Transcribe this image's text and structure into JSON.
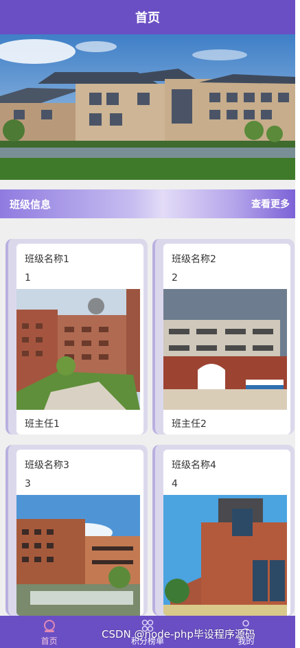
{
  "header": {
    "title": "首页"
  },
  "section": {
    "title": "班级信息",
    "more_label": "查看更多"
  },
  "cards": [
    {
      "name": "班级名称1",
      "number": "1",
      "teacher": "班主任1"
    },
    {
      "name": "班级名称2",
      "number": "2",
      "teacher": "班主任2"
    },
    {
      "name": "班级名称3",
      "number": "3",
      "teacher": ""
    },
    {
      "name": "班级名称4",
      "number": "4",
      "teacher": ""
    }
  ],
  "tabbar": {
    "items": [
      {
        "label": "首页",
        "icon": "home-icon",
        "active": true
      },
      {
        "label": "积分榜单",
        "icon": "ranking-icon",
        "active": false
      },
      {
        "label": "我的",
        "icon": "user-icon",
        "active": false
      }
    ]
  },
  "watermark": "CSDN @node-php毕设程序源码",
  "colors": {
    "primary": "#6a4fc4",
    "tab_active": "#f4c8e0"
  }
}
